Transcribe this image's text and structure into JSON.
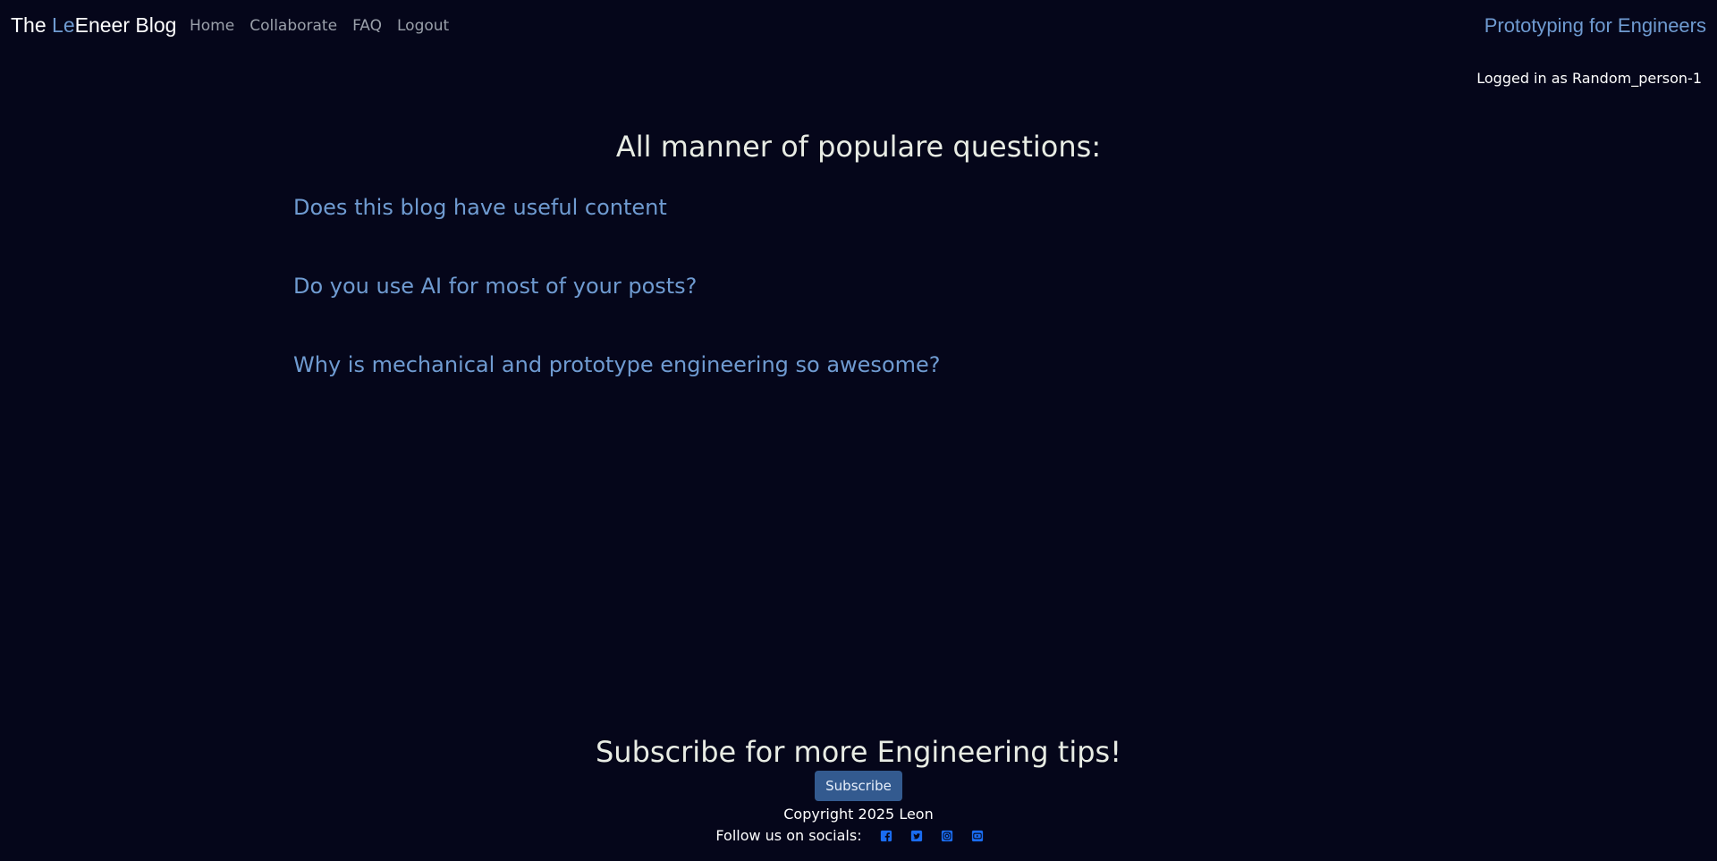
{
  "navbar": {
    "brand_prefix": "The ",
    "brand_accent": "Le",
    "brand_suffix": "Eneer Blog",
    "links": [
      "Home",
      "Collaborate",
      "FAQ",
      "Logout"
    ],
    "site_tag": "Prototyping for Engineers"
  },
  "user": {
    "status": "Logged in as Random_person-1"
  },
  "main": {
    "title": "All manner of populare questions:",
    "questions": [
      "Does this blog have useful content",
      "Do you use AI for most of your posts?",
      "Why is mechanical and prototype engineering so awesome?"
    ]
  },
  "footer": {
    "subscribe_heading": "Subscribe for more Engineering tips!",
    "subscribe_button": "Subscribe",
    "copyright": "Copyright 2025 Leon",
    "socials_label": "Follow us on socials:",
    "social_icons": [
      "facebook-icon",
      "twitter-icon",
      "instagram-icon",
      "youtube-icon"
    ]
  },
  "colors": {
    "background": "#05061a",
    "accent": "#6f9bd1",
    "button": "#335a8f",
    "social_icon": "#1a6cf0"
  }
}
